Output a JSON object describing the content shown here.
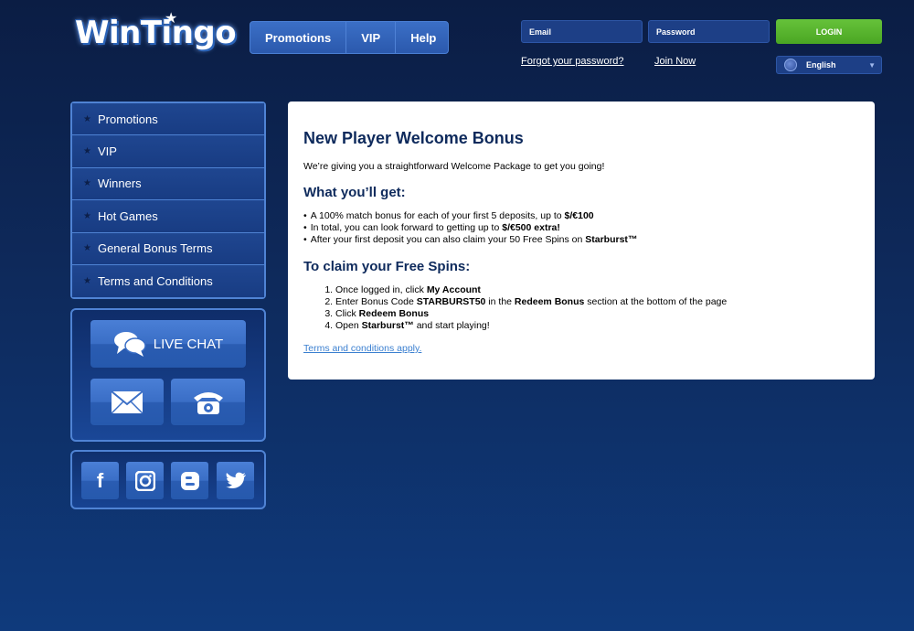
{
  "header": {
    "logo": "WinTingo",
    "nav": [
      "Promotions",
      "VIP",
      "Help"
    ],
    "email_placeholder": "Email",
    "password_placeholder": "Password",
    "login_label": "LOGIN",
    "forgot_link": "Forgot your password?",
    "join_link": "Join Now",
    "language": "English"
  },
  "sidebar": {
    "items": [
      "Promotions",
      "VIP",
      "Winners",
      "Hot Games",
      "General Bonus Terms",
      "Terms and Conditions"
    ],
    "live_chat_label": "LIVE CHAT"
  },
  "content": {
    "title": "New Player Welcome Bonus",
    "intro": "We’re giving you a straightforward Welcome Package to get you going!",
    "get_heading": "What you’ll get:",
    "bullets": [
      {
        "pre": "A 100% match bonus for each of your first 5 deposits, up to ",
        "bold": "$/€100",
        "post": ""
      },
      {
        "pre": "In total, you can look forward to getting up to ",
        "bold": "$/€500 extra!",
        "post": ""
      },
      {
        "pre": "After your first deposit you can also claim your 50 Free Spins on ",
        "bold": "Starburst™",
        "post": ""
      }
    ],
    "claim_heading": "To claim your Free Spins:",
    "steps": [
      {
        "pre": "Once logged in, click ",
        "bold": "My Account",
        "mid": "",
        "bold2": "",
        "post": ""
      },
      {
        "pre": "Enter Bonus Code ",
        "bold": "STARBURST50",
        "mid": " in the ",
        "bold2": "Redeem Bonus",
        "post": " section at the bottom of the page"
      },
      {
        "pre": "Click ",
        "bold": "Redeem Bonus",
        "mid": "",
        "bold2": "",
        "post": ""
      },
      {
        "pre": "Open ",
        "bold": "Starburst™",
        "mid": " and start playing!",
        "bold2": "",
        "post": ""
      }
    ],
    "terms_link": "Terms and conditions apply."
  }
}
